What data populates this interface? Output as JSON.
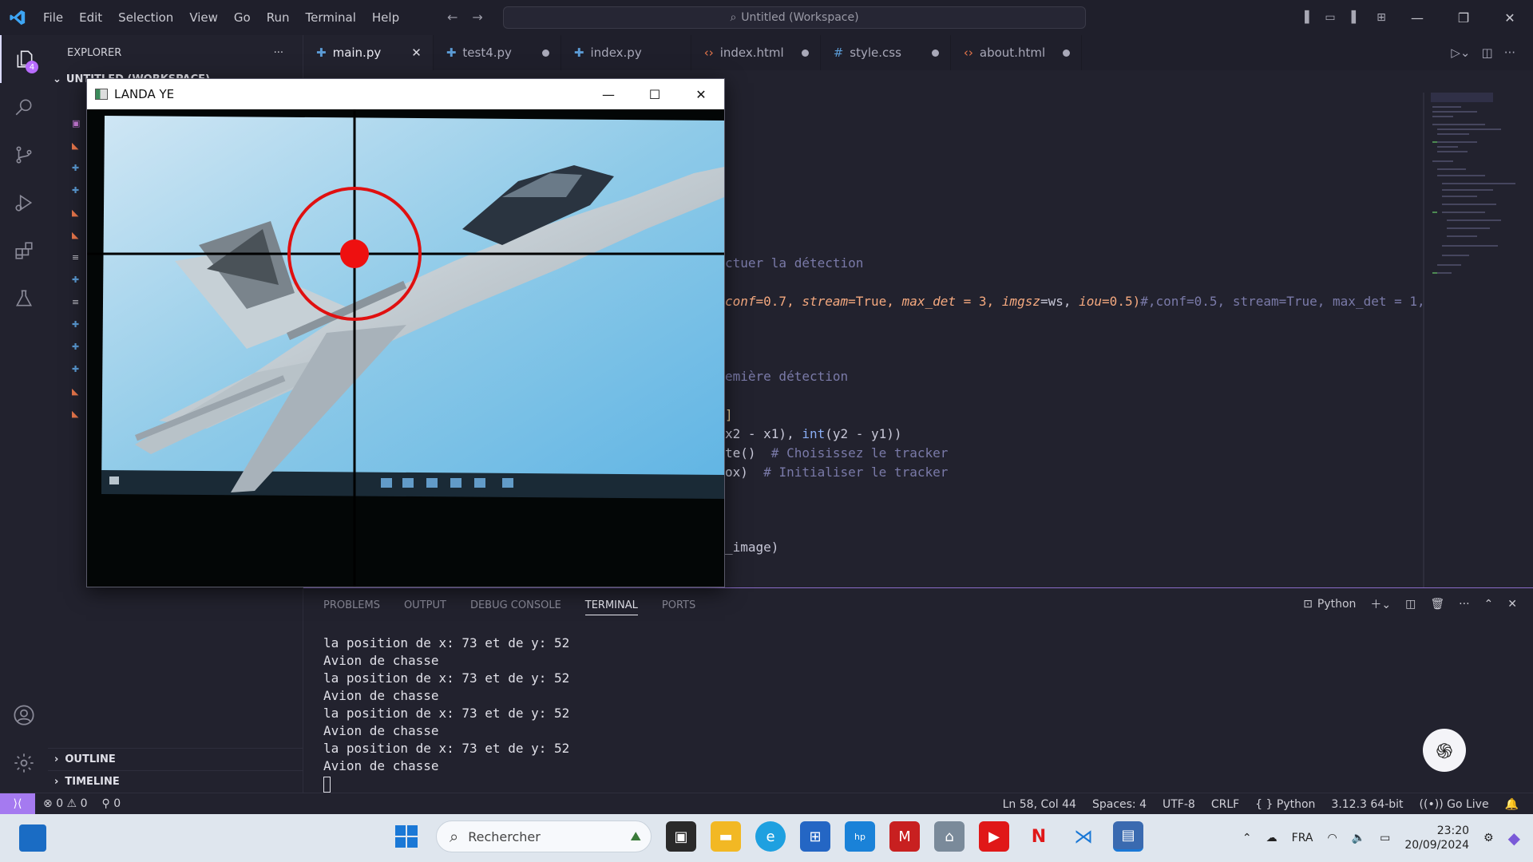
{
  "window": {
    "menu": [
      "File",
      "Edit",
      "Selection",
      "View",
      "Go",
      "Run",
      "Terminal",
      "Help"
    ],
    "search_text": "Untitled (Workspace)"
  },
  "activity": {
    "explorer_badge": "4"
  },
  "sidebar": {
    "title": "EXPLORER",
    "more": "···",
    "workspace": "UNTITLED (WORKSPACE)",
    "sections": [
      "OUTLINE",
      "TIMELINE"
    ]
  },
  "tabs": [
    {
      "label": "main.py",
      "icon": "python-icon",
      "color": "#5b9bd5"
    },
    {
      "label": "test4.py",
      "icon": "python-icon",
      "color": "#5b9bd5"
    },
    {
      "label": "index.py",
      "icon": "python-icon",
      "color": "#5b9bd5"
    },
    {
      "label": "index.html",
      "icon": "html-icon",
      "color": "#e8764b"
    },
    {
      "label": "style.css",
      "icon": "css-icon",
      "color": "#5b9bd5"
    },
    {
      "label": "about.html",
      "icon": "html-icon",
      "color": "#e8764b"
    }
  ],
  "editor": {
    "line1": "ctuer la détection",
    "line2_kw1": "conf",
    "line2_v1": "=0.7, ",
    "line2_kw2": "stream",
    "line2_v2": "=True, ",
    "line2_kw3": "max_det",
    "line2_v3": " = 3, ",
    "line2_kw4": "imgsz",
    "line2_v4": "=ws, ",
    "line2_kw5": "iou",
    "line2_v5": "=0.5)",
    "line2_comment": "#,conf=0.5, stream=True, max_det = 1,",
    "line3": "emière détection",
    "line4": "]",
    "line5a": "x2 - x1), ",
    "line5b": "int",
    "line5c": "(y2 - y1))",
    "line6a": "te()  ",
    "line6b": "# Choisissez le tracker",
    "line7a": "ox)  ",
    "line7b": "# Initialiser le tracker",
    "line8": "_image)"
  },
  "panel": {
    "tabs": [
      "PROBLEMS",
      "OUTPUT",
      "DEBUG CONSOLE",
      "TERMINAL",
      "PORTS"
    ],
    "active_tab": "TERMINAL",
    "shell": "Python",
    "terminal_lines": [
      "la position de x: 73 et de y: 52",
      "Avion de chasse",
      "la position de x: 73 et de y: 52",
      "Avion de chasse",
      "la position de x: 73 et de y: 52",
      "Avion de chasse",
      "la position de x: 73 et de y: 52",
      "Avion de chasse"
    ]
  },
  "statusbar": {
    "errors": "0",
    "warnings": "0",
    "ports": "0",
    "position": "Ln 58, Col 44",
    "spaces": "Spaces: 4",
    "encoding": "UTF-8",
    "eol": "CRLF",
    "language": "Python",
    "interpreter": "3.12.3 64-bit",
    "golive": "Go Live"
  },
  "popup": {
    "title": "LANDA YE"
  },
  "taskbar": {
    "search_placeholder": "Rechercher",
    "lang": "FRA",
    "time": "23:20",
    "date": "20/09/2024"
  },
  "colors": {
    "accent": "#a57af0",
    "crosshair_circle": "#e01010"
  }
}
